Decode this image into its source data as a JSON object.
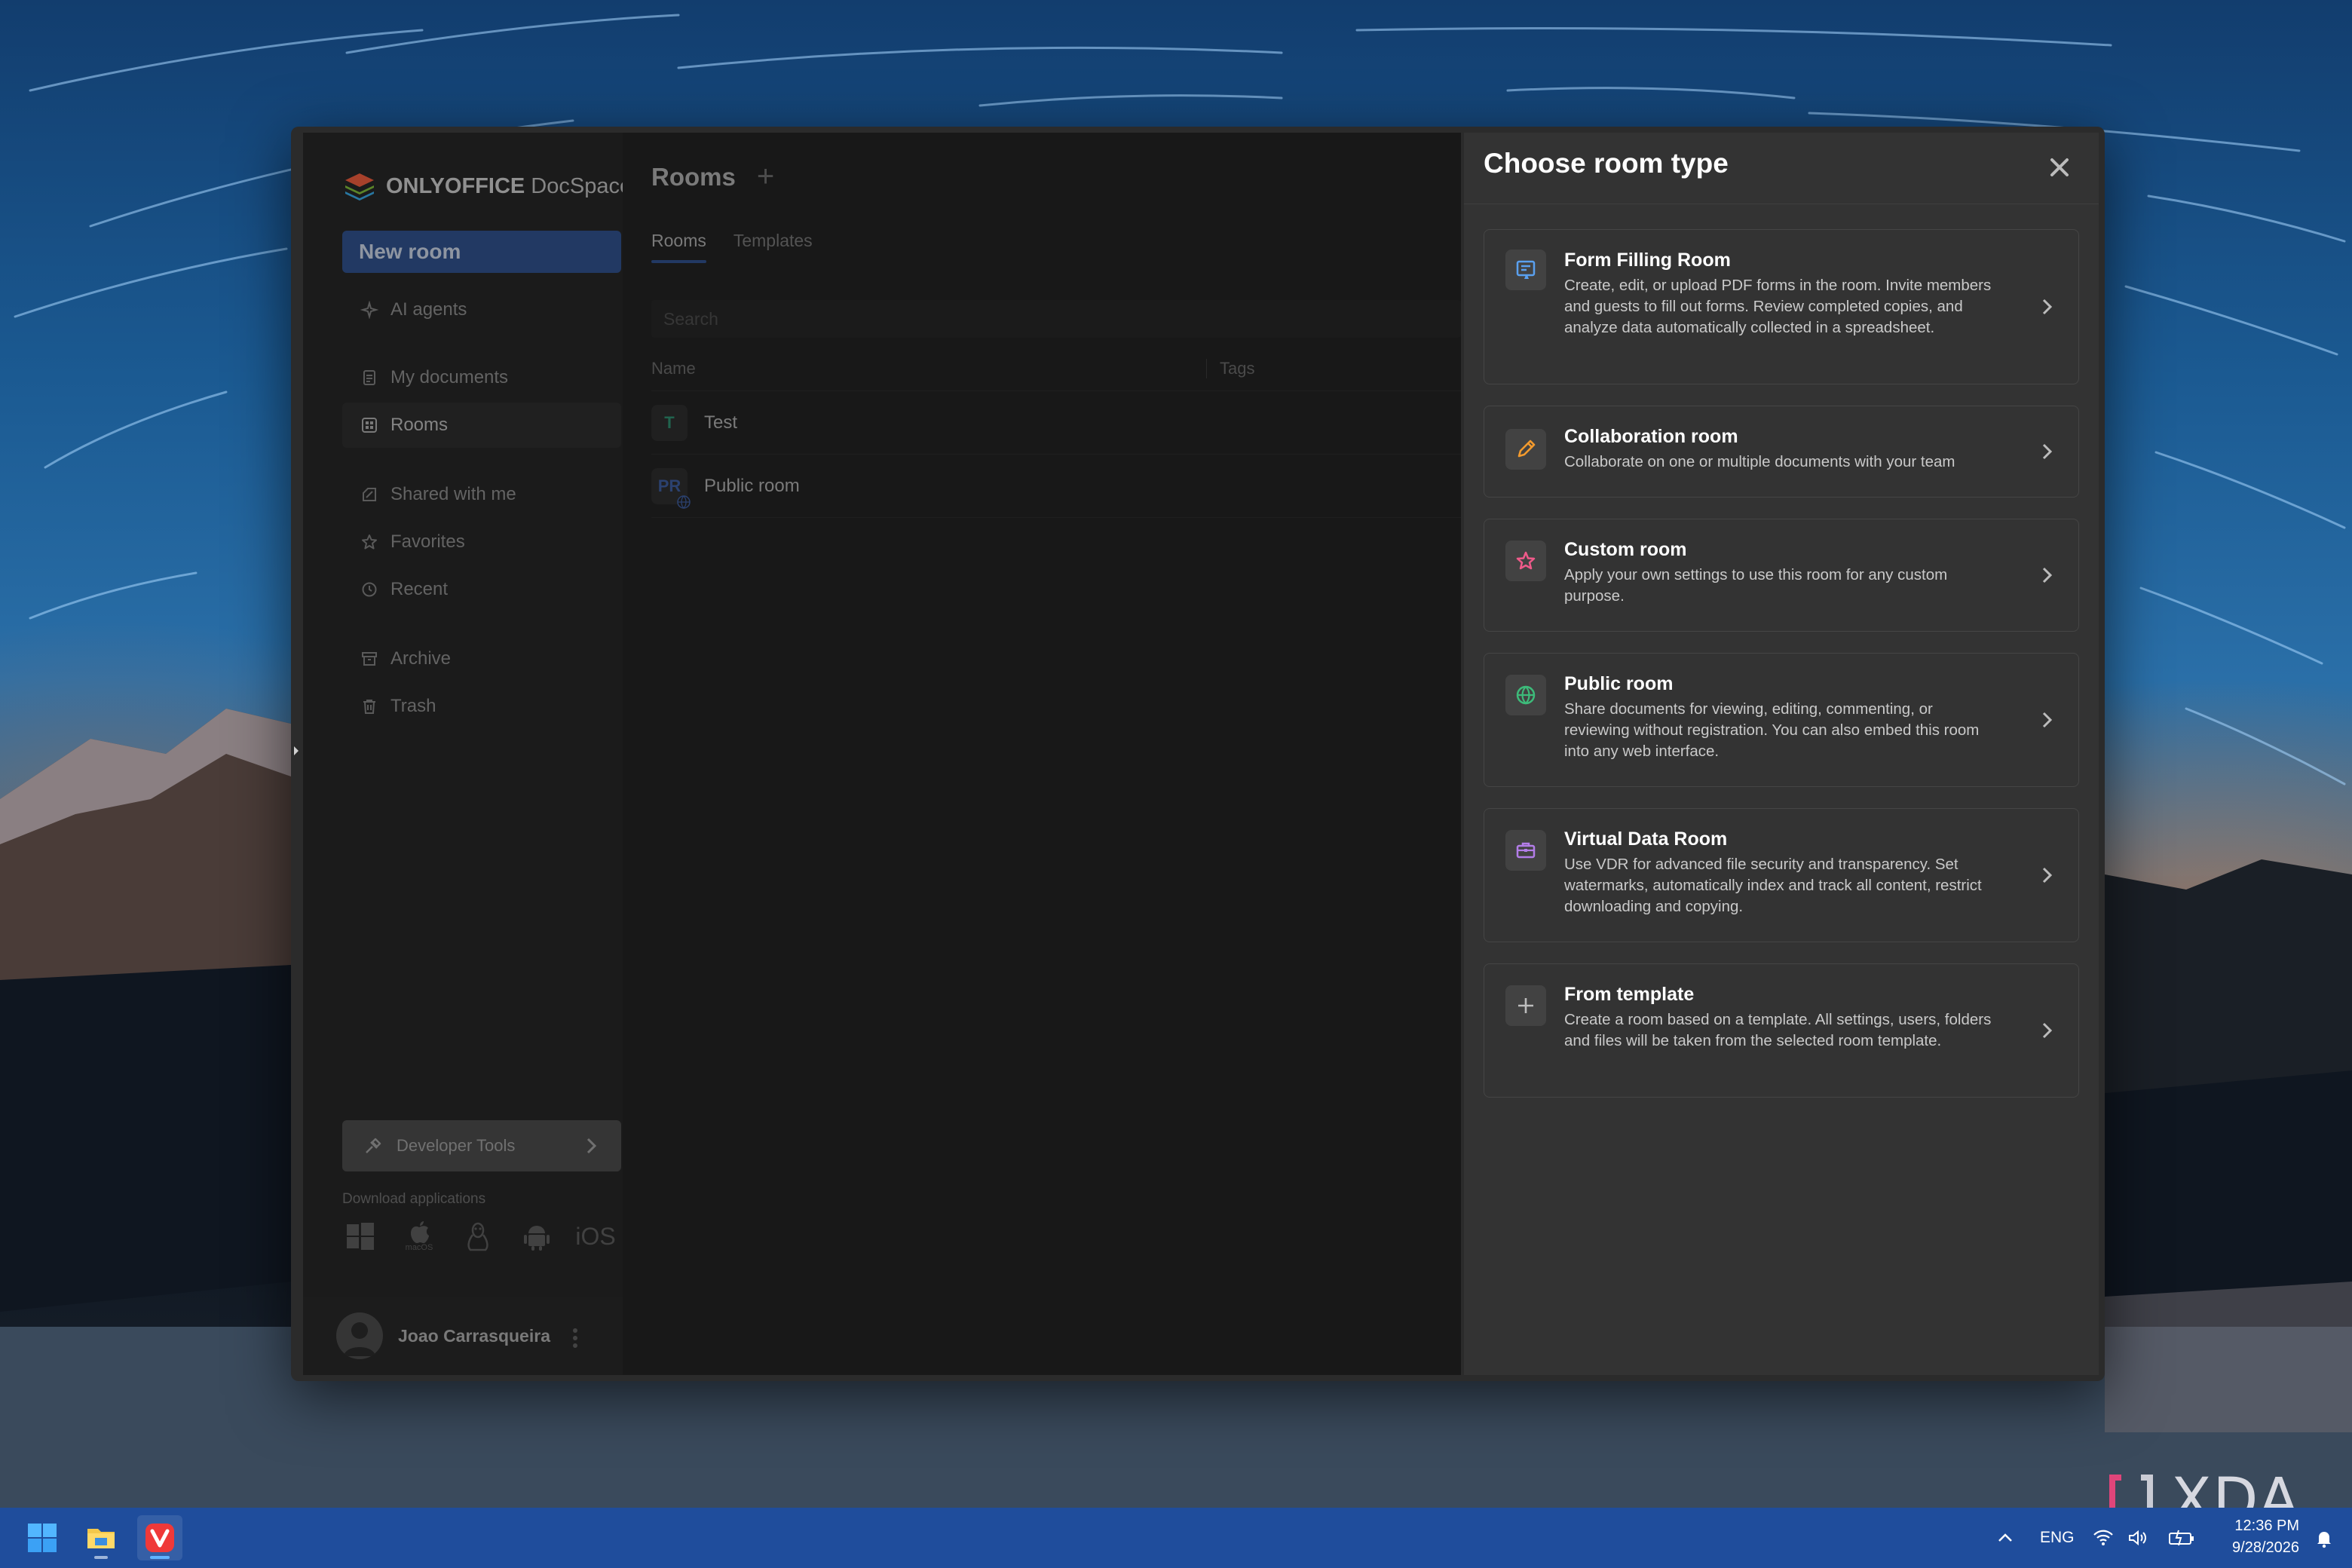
{
  "app": {
    "logo_bold": "ONLYOFFICE",
    "logo_light": " DocSpace",
    "new_room_label": "New room"
  },
  "sidebar": {
    "items": [
      {
        "label": "AI agents",
        "icon": "ai-agents-icon"
      },
      {
        "label": "My documents",
        "icon": "document-icon"
      },
      {
        "label": "Rooms",
        "icon": "rooms-grid-icon",
        "active": true
      },
      {
        "label": "Shared with me",
        "icon": "shared-icon"
      },
      {
        "label": "Favorites",
        "icon": "star-icon"
      },
      {
        "label": "Recent",
        "icon": "history-icon"
      },
      {
        "label": "Archive",
        "icon": "archive-icon"
      },
      {
        "label": "Trash",
        "icon": "trash-icon"
      }
    ],
    "developer_tools_label": "Developer Tools",
    "download_label": "Download applications",
    "download_apps": [
      "windows",
      "macOS",
      "linux",
      "android",
      "iOS"
    ],
    "macos_label": "macOS",
    "ios_label": "iOS",
    "user_name": "Joao Carrasqueira"
  },
  "main": {
    "title": "Rooms",
    "tabs": [
      {
        "label": "Rooms",
        "active": true
      },
      {
        "label": "Templates",
        "active": false
      }
    ],
    "search_placeholder": "Search",
    "columns": [
      "Name",
      "Tags"
    ],
    "rows": [
      {
        "initials": "T",
        "name": "Test",
        "color": "#2e8a6c"
      },
      {
        "initials": "PR",
        "name": "Public room",
        "color": "#3c5a9a"
      }
    ]
  },
  "panel": {
    "title": "Choose room type",
    "cards": [
      {
        "title": "Form Filling Room",
        "description": "Create, edit, or upload PDF forms in the room. Invite members and guests to fill out forms. Review completed copies, and analyze data automatically collected in a spreadsheet.",
        "icon": "form-filling-icon",
        "color": "#5aa0ef"
      },
      {
        "title": "Collaboration room",
        "description": "Collaborate on one or multiple documents with your team",
        "icon": "pencil-icon",
        "color": "#f29a2e"
      },
      {
        "title": "Custom room",
        "description": "Apply your own settings to use this room for any custom purpose.",
        "icon": "star-icon",
        "color": "#ef5a8a"
      },
      {
        "title": "Public room",
        "description": "Share documents for viewing, editing, commenting, or reviewing without registration. You can also embed this room into any web interface.",
        "icon": "globe-icon",
        "color": "#3dbb7a"
      },
      {
        "title": "Virtual Data Room",
        "description": "Use VDR for advanced file security and transparency. Set watermarks, automatically index and track all content, restrict downloading and copying.",
        "icon": "briefcase-icon",
        "color": "#b37de8"
      },
      {
        "title": "From template",
        "description": "Create a room based on a template. All settings, users, folders and files will be taken from the selected room template.",
        "icon": "plus-icon",
        "color": "#bdbdbd"
      }
    ]
  },
  "watermark": {
    "text": "XDA"
  },
  "taskbar": {
    "language": "ENG",
    "time": "12:36 PM",
    "date": "9/28/2026"
  },
  "colors": {
    "accent": "#30508a",
    "panel_bg": "#333333",
    "taskbar": "#1f4d9c"
  }
}
